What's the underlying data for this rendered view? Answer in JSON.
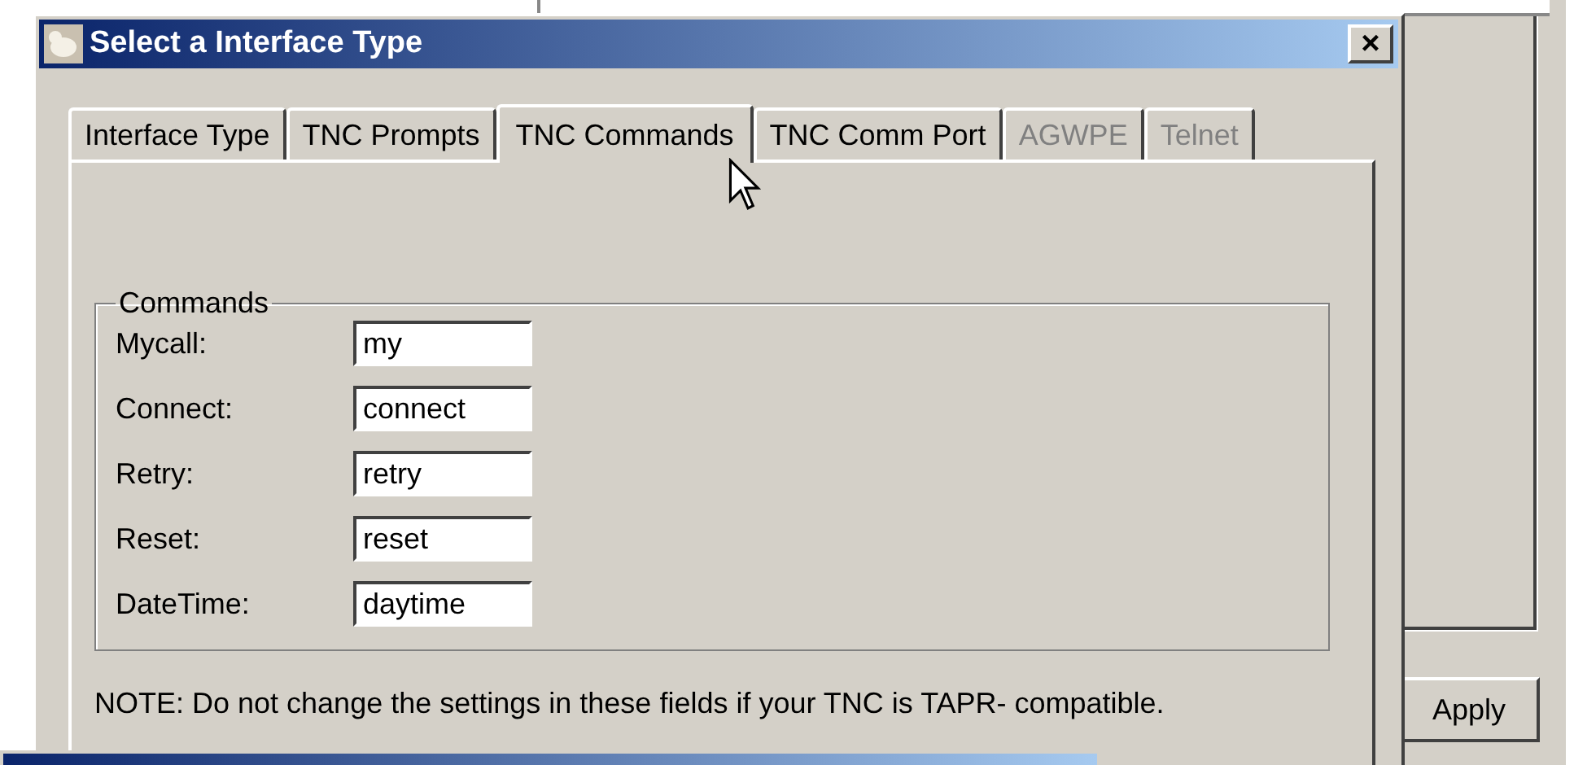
{
  "back_window": {
    "apply_button": "Apply"
  },
  "dialog": {
    "title": "Select a Interface Type",
    "close": "×",
    "tabs": [
      {
        "label": "Interface Type",
        "selected": false,
        "disabled": false
      },
      {
        "label": "TNC Prompts",
        "selected": false,
        "disabled": false
      },
      {
        "label": "TNC Commands",
        "selected": true,
        "disabled": false
      },
      {
        "label": "TNC Comm Port",
        "selected": false,
        "disabled": false
      },
      {
        "label": "AGWPE",
        "selected": false,
        "disabled": true
      },
      {
        "label": "Telnet",
        "selected": false,
        "disabled": true
      }
    ],
    "group": {
      "title": "Commands",
      "fields": [
        {
          "label": "Mycall:",
          "value": "my"
        },
        {
          "label": "Connect:",
          "value": "connect"
        },
        {
          "label": "Retry:",
          "value": "retry"
        },
        {
          "label": "Reset:",
          "value": "reset"
        },
        {
          "label": "DateTime:",
          "value": "daytime"
        }
      ]
    },
    "note": "NOTE:  Do not change the settings in these fields if your TNC is TAPR- compatible."
  }
}
